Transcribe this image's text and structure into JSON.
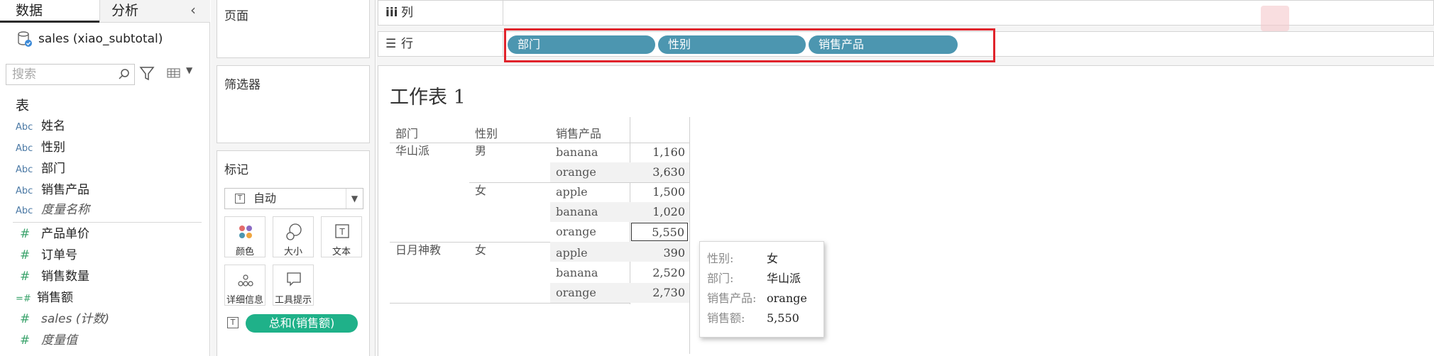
{
  "left_pane": {
    "tabs": [
      "数据",
      "分析"
    ],
    "datasource": "sales (xiao_subtotal)",
    "search_placeholder": "搜索",
    "section_title": "表",
    "dimensions": [
      {
        "type": "Abc",
        "name": "姓名",
        "italic": false
      },
      {
        "type": "Abc",
        "name": "性别",
        "italic": false
      },
      {
        "type": "Abc",
        "name": "部门",
        "italic": false
      },
      {
        "type": "Abc",
        "name": "销售产品",
        "italic": false
      },
      {
        "type": "Abc",
        "name": "度量名称",
        "italic": true
      }
    ],
    "measures": [
      {
        "type": "#",
        "name": "产品单价",
        "italic": false
      },
      {
        "type": "#",
        "name": "订单号",
        "italic": false
      },
      {
        "type": "#",
        "name": "销售数量",
        "italic": false
      },
      {
        "type": "=#",
        "name": "销售额",
        "italic": false
      },
      {
        "type": "#",
        "name": "sales (计数)",
        "italic": true
      },
      {
        "type": "#",
        "name": "度量值",
        "italic": true
      }
    ]
  },
  "cards": {
    "pages": "页面",
    "filters": "筛选器",
    "marks": "标记",
    "mark_type": "自动",
    "mark_buttons": [
      "颜色",
      "大小",
      "文本",
      "详细信息",
      "工具提示"
    ],
    "mark_pill": "总和(销售额)"
  },
  "shelves": {
    "columns_label": "列",
    "rows_label": "行",
    "row_pills": [
      "部门",
      "性别",
      "销售产品"
    ]
  },
  "sheet": {
    "title": "工作表 1",
    "headers": [
      "部门",
      "性别",
      "销售产品"
    ],
    "rows": [
      {
        "dept": "华山派",
        "gender": "男",
        "product": "banana",
        "value": "1,160"
      },
      {
        "dept": "",
        "gender": "",
        "product": "orange",
        "value": "3,630"
      },
      {
        "dept": "",
        "gender": "女",
        "product": "apple",
        "value": "1,500"
      },
      {
        "dept": "",
        "gender": "",
        "product": "banana",
        "value": "1,020"
      },
      {
        "dept": "",
        "gender": "",
        "product": "orange",
        "value": "5,550"
      },
      {
        "dept": "日月神教",
        "gender": "女",
        "product": "apple",
        "value": "390"
      },
      {
        "dept": "",
        "gender": "",
        "product": "banana",
        "value": "2,520"
      },
      {
        "dept": "",
        "gender": "",
        "product": "orange",
        "value": "2,730"
      }
    ]
  },
  "tooltip": {
    "rows": [
      {
        "key": "性别:",
        "value": "女"
      },
      {
        "key": "部门:",
        "value": "华山派"
      },
      {
        "key": "销售产品:",
        "value": "orange"
      },
      {
        "key": "销售额:",
        "value": "5,550"
      }
    ]
  },
  "colors": {
    "row_pill": "#4c96b0",
    "measure_pill": "#1fb189",
    "highlight": "#e0232b"
  }
}
